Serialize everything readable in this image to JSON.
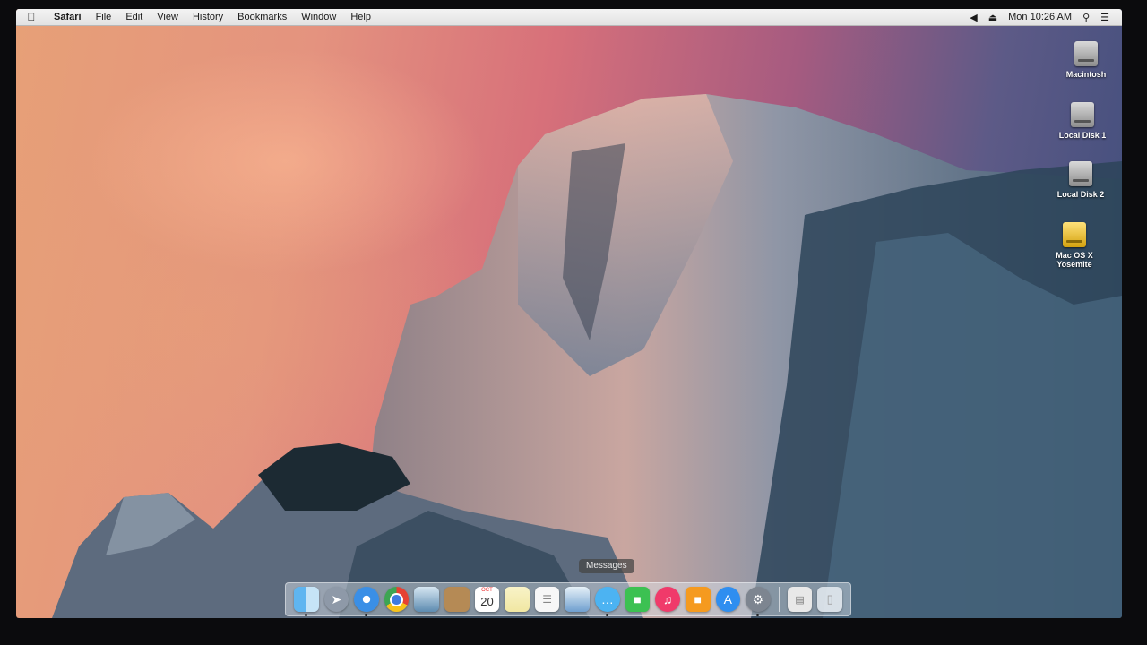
{
  "menubar": {
    "app_name": "Safari",
    "items": [
      "File",
      "Edit",
      "View",
      "History",
      "Bookmarks",
      "Window",
      "Help"
    ],
    "clock": "Mon 10:26 AM"
  },
  "desktop": {
    "icons": [
      {
        "label": "Macintosh",
        "icon": "hard-drive-icon"
      },
      {
        "label": "Local Disk 1",
        "icon": "hard-drive-icon"
      },
      {
        "label": "Local Disk 2",
        "icon": "hard-drive-icon"
      },
      {
        "label": "Mac OS X Yosemite",
        "icon": "installer-disk-icon"
      }
    ]
  },
  "tooltip": "Messages",
  "dock": {
    "calendar": {
      "month": "OCT",
      "day": "20"
    },
    "items": [
      {
        "name": "finder",
        "icon": "finder-icon"
      },
      {
        "name": "launchpad",
        "icon": "rocket-icon"
      },
      {
        "name": "safari",
        "icon": "compass-icon"
      },
      {
        "name": "chrome",
        "icon": "chrome-icon"
      },
      {
        "name": "preview",
        "icon": "photo-icon"
      },
      {
        "name": "contacts",
        "icon": "contacts-book-icon"
      },
      {
        "name": "calendar",
        "icon": "calendar-icon"
      },
      {
        "name": "notes",
        "icon": "notes-icon"
      },
      {
        "name": "reminders",
        "icon": "list-icon"
      },
      {
        "name": "keynote",
        "icon": "presentation-icon"
      },
      {
        "name": "messages",
        "icon": "speech-bubble-icon"
      },
      {
        "name": "facetime",
        "icon": "video-camera-icon"
      },
      {
        "name": "itunes",
        "icon": "music-note-icon"
      },
      {
        "name": "ibooks",
        "icon": "book-icon"
      },
      {
        "name": "app-store",
        "icon": "app-store-icon"
      },
      {
        "name": "system-preferences",
        "icon": "gear-icon"
      },
      {
        "name": "downloads",
        "icon": "document-icon"
      },
      {
        "name": "trash",
        "icon": "trash-icon"
      }
    ]
  },
  "colors": {
    "menubar": "#e8e8e8",
    "sky_left": "#e7a077",
    "sky_right": "#3c4c7a"
  }
}
